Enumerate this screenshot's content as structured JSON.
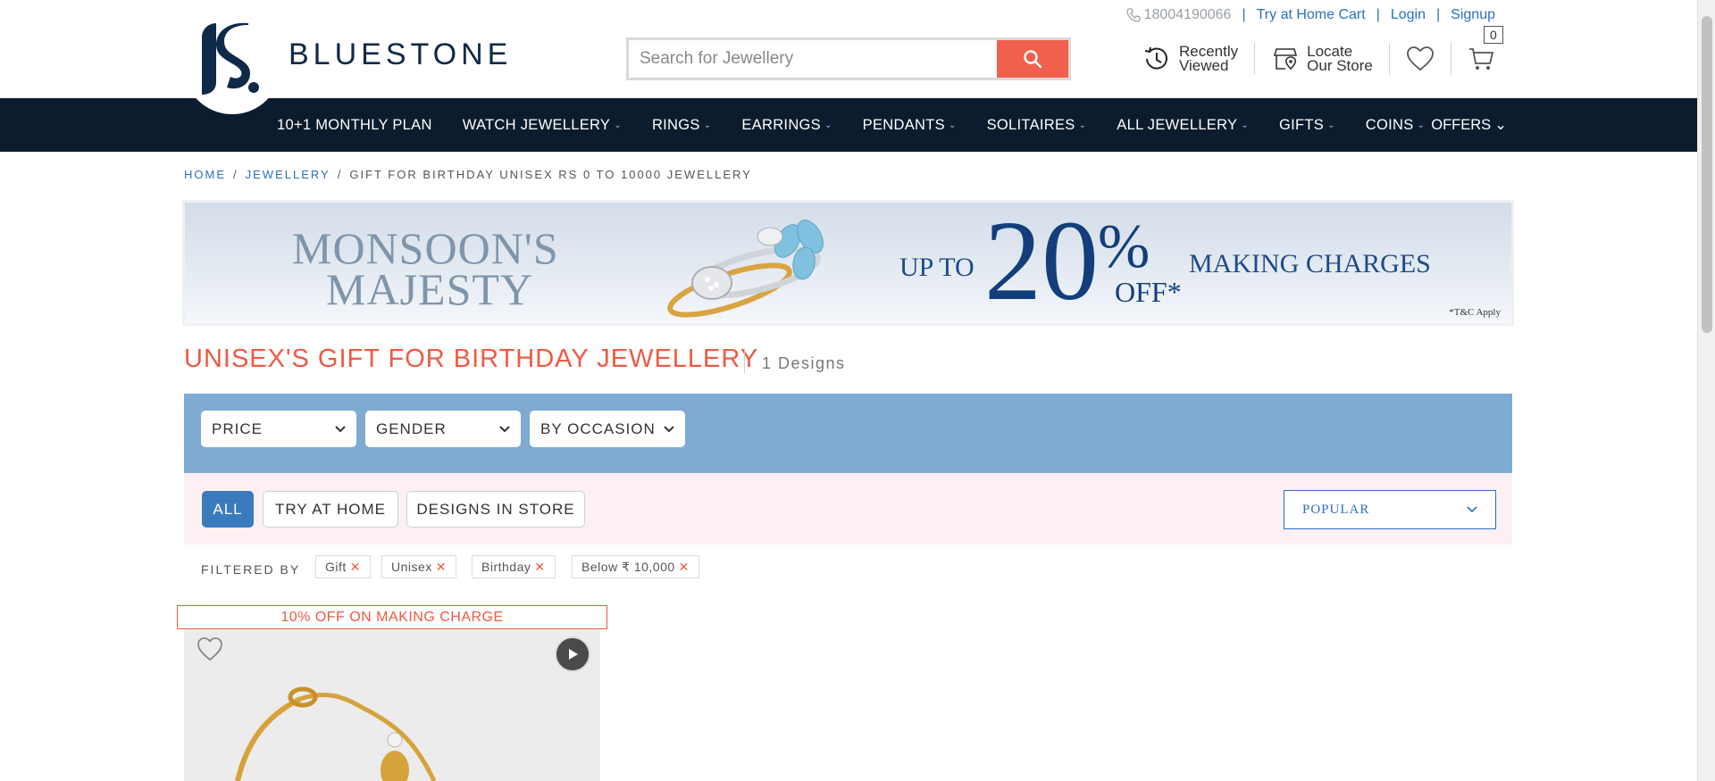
{
  "header": {
    "brand": "BLUESTONE",
    "phone": "18004190066",
    "links": {
      "try_home_cart": "Try at Home Cart",
      "login": "Login",
      "signup": "Signup"
    },
    "search_placeholder": "Search for Jewellery",
    "recently_viewed": [
      "Recently",
      "Viewed"
    ],
    "locate_store": [
      "Locate",
      "Our Store"
    ],
    "cart_count": "0"
  },
  "nav": {
    "items": [
      {
        "label": "10+1 MONTHLY PLAN",
        "dropdown": false
      },
      {
        "label": "WATCH JEWELLERY",
        "dropdown": true
      },
      {
        "label": "RINGS",
        "dropdown": true
      },
      {
        "label": "EARRINGS",
        "dropdown": true
      },
      {
        "label": "PENDANTS",
        "dropdown": true
      },
      {
        "label": "SOLITAIRES",
        "dropdown": true
      },
      {
        "label": "ALL JEWELLERY",
        "dropdown": true
      },
      {
        "label": "GIFTS",
        "dropdown": true
      },
      {
        "label": "COINS",
        "dropdown": true
      }
    ],
    "offers": "OFFERS"
  },
  "breadcrumb": {
    "home": "HOME",
    "jewellery": "JEWELLERY",
    "current": "GIFT FOR BIRTHDAY UNISEX RS 0 TO 10000 JEWELLERY"
  },
  "banner": {
    "title_line1": "MONSOON'S",
    "title_line2": "MAJESTY",
    "up_to": "UP TO",
    "percent": "20",
    "percent_symbol": "%",
    "off": "OFF*",
    "making": "MAKING CHARGES",
    "tc": "*T&C Apply"
  },
  "listing": {
    "title": "UNISEX'S GIFT FOR BIRTHDAY JEWELLERY",
    "count": "1 Designs"
  },
  "filters": {
    "dropdowns": [
      "PRICE",
      "GENDER",
      "BY OCCASION"
    ],
    "tabs": [
      "ALL",
      "TRY AT HOME",
      "DESIGNS IN STORE"
    ],
    "sort": "POPULAR",
    "filtered_by_label": "FILTERED BY",
    "chips": [
      "Gift",
      "Unisex",
      "Birthday",
      "Below ₹ 10,000"
    ]
  },
  "product": {
    "offer": "10% OFF ON MAKING CHARGE"
  },
  "colors": {
    "accent": "#ee5a42",
    "nav_bg": "#0d1b2e",
    "filter_bar": "#7faad1",
    "link": "#2c6fbf"
  }
}
